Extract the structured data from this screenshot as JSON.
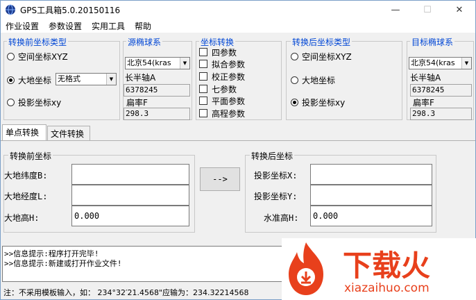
{
  "window": {
    "title": "GPS工具箱5.0.20150116",
    "minimize": "—",
    "maximize": "☐",
    "close": "✕"
  },
  "menu": [
    "作业设置",
    "参数设置",
    "实用工具",
    "帮助"
  ],
  "src_coord_type": {
    "title": "转换前坐标类型",
    "options": [
      "空间坐标XYZ",
      "大地坐标",
      "投影坐标xy"
    ],
    "selected_index": 1,
    "format_select": "无格式"
  },
  "src_ellipsoid": {
    "title": "源椭球系",
    "select": "北京54(kras",
    "semi_major_label": "长半轴A",
    "semi_major_value": "6378245",
    "flattening_label": "扁率F",
    "flattening_value": "298.3"
  },
  "transform": {
    "title": "坐标转换",
    "options": [
      "四参数",
      "拟合参数",
      "校正参数",
      "七参数",
      "平面参数",
      "高程参数"
    ]
  },
  "dst_coord_type": {
    "title": "转换后坐标类型",
    "options": [
      "空间坐标XYZ",
      "大地坐标",
      "投影坐标xy"
    ],
    "selected_index": 2
  },
  "dst_ellipsoid": {
    "title": "目标椭球系",
    "select": "北京54(kras",
    "semi_major_label": "长半轴A",
    "semi_major_value": "6378245",
    "flattening_label": "扁率F",
    "flattening_value": "298.3"
  },
  "tabs": [
    "单点转换",
    "文件转换"
  ],
  "before": {
    "title": "转换前坐标",
    "lat_label": "大地纬度B:",
    "lat_value": "",
    "lon_label": "大地经度L:",
    "lon_value": "",
    "h_label": "大地高H:",
    "h_value": "0.000"
  },
  "convert_button": "-->",
  "after": {
    "title": "转换后坐标",
    "x_label": "投影坐标X:",
    "x_value": "",
    "y_label": "投影坐标Y:",
    "y_value": "",
    "h_label": "水准高H:",
    "h_value": "0.000"
  },
  "log": [
    ">>信息提示:程序打开完毕!",
    ">>信息提示:新建或打开作业文件!"
  ],
  "status": "注：不采用模板输入，如： 234°32′21.4568\"应输为：234.32214568",
  "watermark": {
    "brand": "下载火",
    "url": "xiazaihuo.com",
    "color": "#e8401c"
  }
}
